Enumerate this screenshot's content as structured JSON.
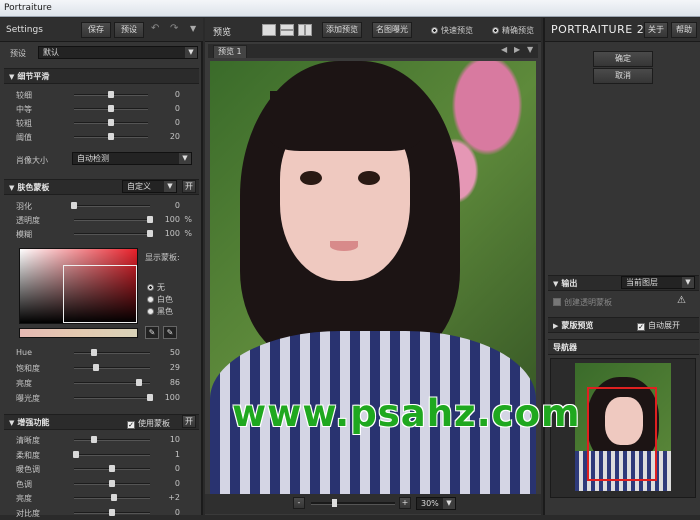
{
  "window": {
    "title": "Portraiture"
  },
  "left": {
    "settings_title": "Settings",
    "save_label": "保存",
    "preset_label": "预设",
    "undo_icon": "undo-icon",
    "redo_icon": "redo-icon",
    "preset_row_label": "预设",
    "preset_value": "默认",
    "detail_section": {
      "title": "细节平滑",
      "sliders": [
        {
          "label": "较细",
          "value": "0",
          "level": 0.5
        },
        {
          "label": "中等",
          "value": "0",
          "level": 0.5
        },
        {
          "label": "较粗",
          "value": "0",
          "level": 0.5
        },
        {
          "label": "阈值",
          "value": "20",
          "level": 0.5
        }
      ],
      "portrait_size_label": "肖像大小",
      "portrait_size_value": "自动检测"
    },
    "skin_section": {
      "title": "肤色蒙板",
      "mode_value": "自定义",
      "toggle_label": "开",
      "sliders": [
        {
          "label": "羽化",
          "value": "0",
          "unit": "",
          "level": 0.0
        },
        {
          "label": "透明度",
          "value": "100",
          "unit": "%",
          "level": 1.0
        },
        {
          "label": "模糊",
          "value": "100",
          "unit": "%",
          "level": 1.0
        }
      ],
      "display_mask_label": "显示蒙板:",
      "radio_options": [
        {
          "label": "无",
          "selected": true
        },
        {
          "label": "白色",
          "selected": false
        },
        {
          "label": "黑色",
          "selected": false
        }
      ],
      "hsl_sliders": [
        {
          "label": "Hue",
          "value": "50",
          "level": 0.26
        },
        {
          "label": "饱和度",
          "value": "29",
          "level": 0.29
        },
        {
          "label": "亮度",
          "value": "86",
          "level": 0.86
        },
        {
          "label": "曝光度",
          "value": "100",
          "level": 1.0
        }
      ]
    },
    "enhance_section": {
      "title": "增强功能",
      "use_mask_label": "使用蒙板",
      "use_mask_checked": true,
      "toggle_label": "开",
      "sliders": [
        {
          "label": "清晰度",
          "value": "10",
          "level": 0.26
        },
        {
          "label": "柔和度",
          "value": "1",
          "level": 0.02
        },
        {
          "label": "暖色调",
          "value": "0",
          "level": 0.5
        },
        {
          "label": "色调",
          "value": "0",
          "level": 0.5
        },
        {
          "label": "亮度",
          "value": "+2",
          "level": 0.53
        },
        {
          "label": "对比度",
          "value": "0",
          "level": 0.5
        }
      ]
    }
  },
  "center": {
    "preview_title": "预览",
    "add_preview_label": "添加预览",
    "zone_exposure_label": "名图曝光",
    "quick_preview_label": "快速预览",
    "precise_preview_label": "精确预览",
    "tab_label": "预览 1",
    "zoom_minus": "-",
    "zoom_plus": "+",
    "zoom_value": "30%",
    "zoom_level": 0.27
  },
  "right": {
    "brand_light": "PORTRAITURE",
    "brand_version": "2",
    "about_label": "关于",
    "help_label": "帮助",
    "ok_label": "确定",
    "cancel_label": "取消",
    "output_label": "输出",
    "output_value": "当前图层",
    "transparent_label": "创建透明蒙板",
    "mask_preview_label": "蒙版预览",
    "auto_expand_label": "自动展开",
    "navigator_label": "导航器"
  },
  "watermark": {
    "text": "www.psahz.com"
  },
  "colors": {
    "accent_red": "#e02020",
    "watermark_green": "#1fa81f"
  }
}
